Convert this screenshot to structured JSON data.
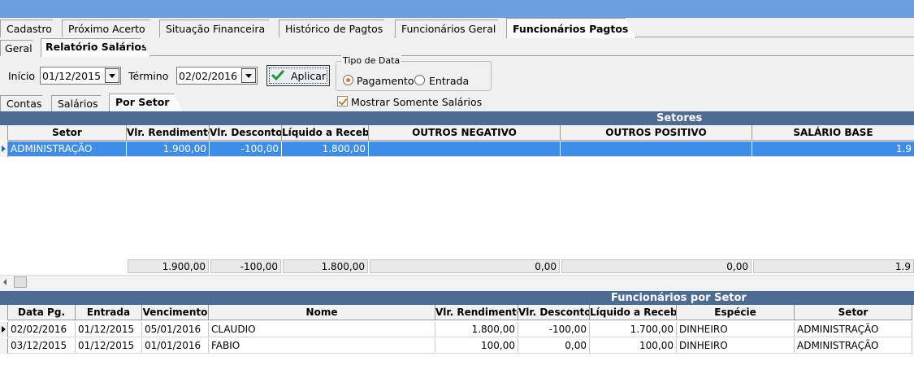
{
  "top_tabs": [
    {
      "label": "Cadastro"
    },
    {
      "label": "Próximo Acerto"
    },
    {
      "label": "Situação Financeira"
    },
    {
      "label": "Histórico de Pagtos"
    },
    {
      "label": "Funcionários Geral"
    },
    {
      "label": "Funcionários Pagtos"
    }
  ],
  "sub_tabs": [
    {
      "label": "Geral"
    },
    {
      "label": "Relatório Salários"
    }
  ],
  "filters": {
    "inicio_label": "Início",
    "inicio_value": "01/12/2015",
    "termino_label": "Término",
    "termino_value": "02/02/2016",
    "apply_label": "Aplicar",
    "tipo_data_legend": "Tipo de Data",
    "radio_pagamento": "Pagamento",
    "radio_entrada": "Entrada",
    "mostrar_salarios": "Mostrar Somente Salários"
  },
  "sector_tabs": [
    {
      "label": "Contas"
    },
    {
      "label": "Salários"
    },
    {
      "label": "Por Setor"
    }
  ],
  "setores": {
    "title": "Setores",
    "columns": [
      "Setor",
      "Vlr. Rendimentos",
      "Vlr. Descontos",
      "Líquido a Receber",
      "OUTROS NEGATIVO",
      "OUTROS POSITIVO",
      "SALÁRIO BASE"
    ],
    "rows": [
      [
        "ADMINISTRAÇÃO",
        "1.900,00",
        "-100,00",
        "1.800,00",
        "",
        "",
        "1.9"
      ]
    ],
    "totals": [
      "1.900,00",
      "-100,00",
      "1.800,00",
      "0,00",
      "0,00",
      "1.9"
    ]
  },
  "funcionarios": {
    "title": "Funcionários por Setor",
    "columns": [
      "Data Pg.",
      "Entrada",
      "Vencimento",
      "Nome",
      "Vlr. Rendimentos",
      "Vlr. Descontos",
      "Líquido a Receber",
      "Espécie",
      "Setor"
    ],
    "rows": [
      [
        "02/02/2016",
        "01/12/2015",
        "05/01/2016",
        "CLAUDIO",
        "1.800,00",
        "-100,00",
        "1.700,00",
        "DINHEIRO",
        "ADMINISTRAÇÃO"
      ],
      [
        "03/12/2015",
        "01/12/2015",
        "01/01/2016",
        "FABIO",
        "100,00",
        "0,00",
        "100,00",
        "DINHEIRO",
        "ADMINISTRAÇÃO"
      ]
    ]
  },
  "colors": {
    "titlebar": "#6aa0de",
    "band_header": "#4e6c93",
    "selection": "#3e8ee8"
  }
}
